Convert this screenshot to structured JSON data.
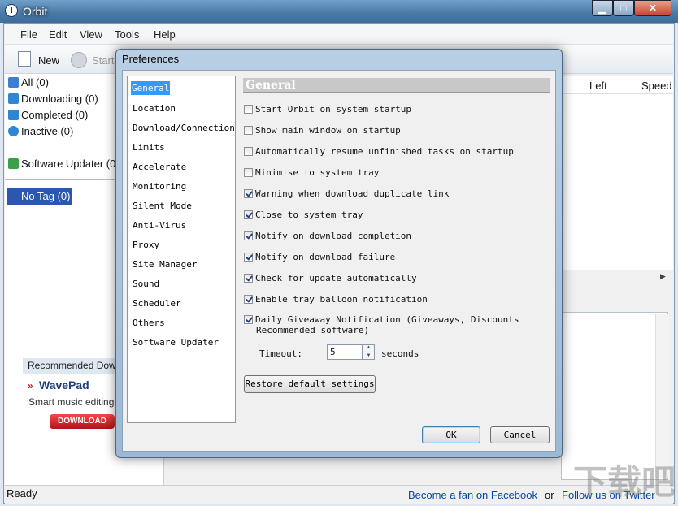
{
  "window": {
    "title": "Orbit",
    "controls": {
      "minimize": "▁",
      "maximize": "□",
      "close": "✕"
    }
  },
  "menu": [
    "File",
    "Edit",
    "View",
    "Tools",
    "Help"
  ],
  "toolbar": {
    "new_label": "New",
    "start_label": "Start"
  },
  "sidebar": {
    "categories": [
      {
        "label": "All (0)",
        "icon": "list-icon",
        "color": "#3b7fd4"
      },
      {
        "label": "Downloading (0)",
        "icon": "download-icon",
        "color": "#2f86d6"
      },
      {
        "label": "Completed (0)",
        "icon": "completed-icon",
        "color": "#2f86d6"
      },
      {
        "label": "Inactive (0)",
        "icon": "inactive-icon",
        "color": "#2f86d6"
      }
    ],
    "updater": "Software Updater (0",
    "tag": "No Tag (0)",
    "recommended_header": "Recommended Dow",
    "promo_title": "WavePad",
    "promo_desc": "Smart music editing",
    "promo_button": "DOWNLOAD"
  },
  "list": {
    "columns": [
      "Left",
      "Speed"
    ]
  },
  "status": {
    "ready": "Ready",
    "facebook": "Become a fan on Facebook",
    "or": "or",
    "twitter": "Follow us on Twitter"
  },
  "dialog": {
    "title": "Preferences",
    "nav": [
      "General",
      "Location",
      "Download/Connection",
      "Limits",
      "Accelerate",
      "Monitoring",
      "Silent Mode",
      "Anti-Virus",
      "Proxy",
      "Site Manager",
      "Sound",
      "Scheduler",
      "Others",
      "Software Updater"
    ],
    "selected_nav": "General",
    "section_title": "General",
    "options": [
      {
        "label": "Start Orbit on system startup",
        "checked": false
      },
      {
        "label": "Show main window on startup",
        "checked": false
      },
      {
        "label": "Automatically resume unfinished tasks on startup",
        "checked": false
      },
      {
        "label": "Minimise to system tray",
        "checked": false
      },
      {
        "label": "Warning when download duplicate link",
        "checked": true
      },
      {
        "label": "Close to system tray",
        "checked": true
      },
      {
        "label": "Notify on download completion",
        "checked": true
      },
      {
        "label": "Notify on download failure",
        "checked": true
      },
      {
        "label": "Check for update automatically",
        "checked": true
      },
      {
        "label": "Enable tray balloon notification",
        "checked": true
      },
      {
        "label": "Daily Giveaway Notification (Giveaways, Discounts",
        "checked": true
      }
    ],
    "option_continuation": "Recommended software)",
    "timeout_label": "Timeout:",
    "timeout_value": "5",
    "seconds_label": "seconds",
    "restore_button": "Restore default settings",
    "ok_button": "OK",
    "cancel_button": "Cancel"
  },
  "watermark": "下载吧"
}
